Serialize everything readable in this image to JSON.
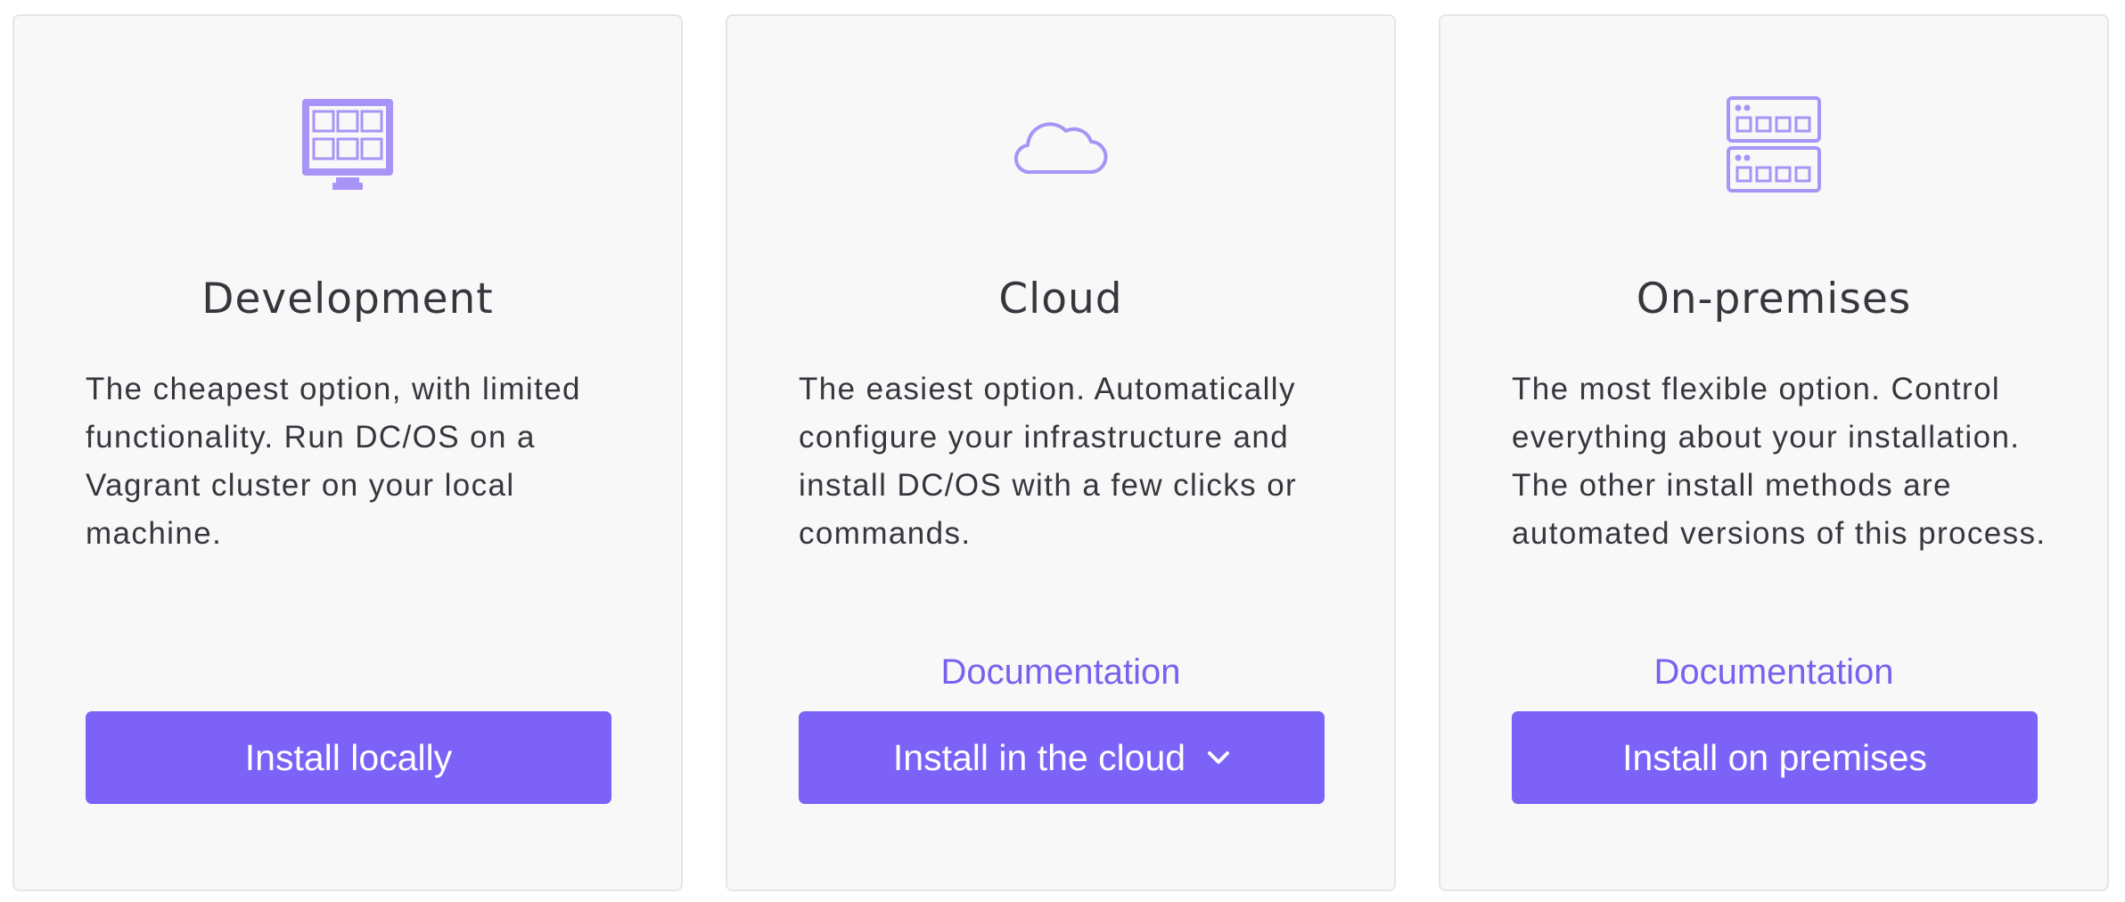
{
  "cards": [
    {
      "icon": "monitor-icon",
      "title": "Development",
      "description": "The cheapest option, with limited functionality. Run DC/OS on a Vagrant cluster on your local machine.",
      "button_label": "Install locally"
    },
    {
      "icon": "cloud-icon",
      "title": "Cloud",
      "description": "The easiest option. Automatically configure your infrastructure and install DC/OS with a few clicks or commands.",
      "link_label": "Documentation",
      "button_label": "Install in the cloud",
      "button_icon": "chevron-down-icon"
    },
    {
      "icon": "server-rack-icon",
      "title": "On-premises",
      "description": "The most flexible option. Control everything about your installation. The other install methods are automated versions of this process.",
      "link_label": "Documentation",
      "button_label": "Install on premises"
    }
  ],
  "colors": {
    "accent": "#7d62f8",
    "icon": "#a894f6",
    "link": "#7b60ef",
    "card_background": "#f8f8f9",
    "card_border": "#e6e6e9",
    "text": "#36363d"
  }
}
